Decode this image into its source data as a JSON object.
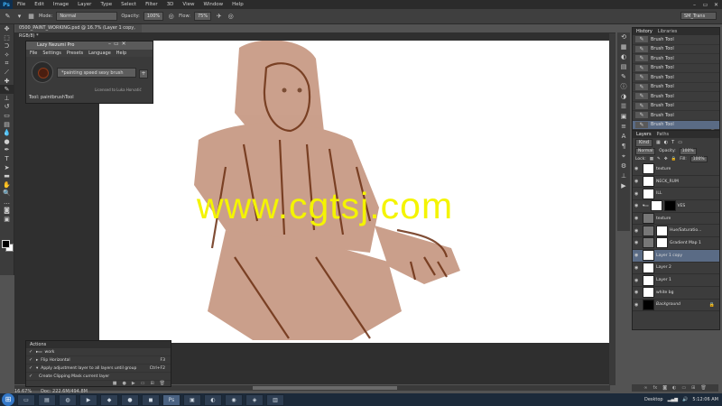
{
  "app": {
    "logo": "Ps"
  },
  "menubar": {
    "items": [
      "File",
      "Edit",
      "Image",
      "Layer",
      "Type",
      "Select",
      "Filter",
      "3D",
      "View",
      "Window",
      "Help"
    ]
  },
  "window_controls": {
    "minimize": "–",
    "maximize": "▭",
    "close": "✕"
  },
  "options": {
    "mode_label": "Mode:",
    "mode_value": "Normal",
    "opacity_label": "Opacity:",
    "opacity_value": "100%",
    "flow_label": "Flow:",
    "flow_value": "75%",
    "workspace": "SM_Trans"
  },
  "document": {
    "tab": "0500_PAINT_WORKING.psd @ 16.7% (Layer 1 copy, RGB/8) *"
  },
  "lazy_nezumi": {
    "title": "Lazy Nezumi Pro",
    "menu": [
      "File",
      "Settings",
      "Presets",
      "Language",
      "Help"
    ],
    "preset": "*painting speed sexy brush",
    "license": "Licensed to Luka Horvatić",
    "tool_line": "Tool: paintbrushTool"
  },
  "actions": {
    "header": "Actions",
    "rows": [
      {
        "label": "work",
        "shortcut": ""
      },
      {
        "label": "Flip Horizontal",
        "shortcut": "F3"
      },
      {
        "label": "Apply adjustment layer to all layers until group",
        "shortcut": "Ctrl+F2"
      },
      {
        "label": "Create Clipping Mask current layer",
        "shortcut": ""
      }
    ]
  },
  "history": {
    "tabs": [
      "History",
      "Libraries"
    ],
    "items": [
      "Brush Tool",
      "Brush Tool",
      "Brush Tool",
      "Brush Tool",
      "Brush Tool",
      "Brush Tool",
      "Brush Tool",
      "Brush Tool",
      "Brush Tool",
      "Brush Tool"
    ]
  },
  "layers": {
    "tabs": [
      "Layers",
      "Paths"
    ],
    "filter_label": "Kind",
    "blend": "Normal",
    "opacity_label": "Opacity:",
    "opacity": "100%",
    "lock_label": "Lock:",
    "fill_label": "Fill:",
    "fill": "100%",
    "items": [
      {
        "name": "texture",
        "lock": ""
      },
      {
        "name": "NECK_RUM",
        "lock": ""
      },
      {
        "name": "ILL",
        "lock": ""
      },
      {
        "name": "VES",
        "lock": ""
      },
      {
        "name": "texture",
        "lock": ""
      },
      {
        "name": "Hue/Saturatio...",
        "lock": ""
      },
      {
        "name": "Gradient Map 1",
        "lock": ""
      },
      {
        "name": "Layer 1 copy",
        "lock": ""
      },
      {
        "name": "Layer 2",
        "lock": ""
      },
      {
        "name": "Layer 1",
        "lock": ""
      },
      {
        "name": "white bg",
        "lock": ""
      },
      {
        "name": "Background",
        "lock": "🔒"
      }
    ]
  },
  "status": {
    "zoom": "16.67%",
    "doc": "Doc: 222.6M/494.8M"
  },
  "canvas": {
    "watermark": "www.cgtsj.com",
    "paint_color": "#a0522d"
  },
  "taskbar": {
    "desktop": "Desktop",
    "time": "5:12:06 AM"
  },
  "colors": {
    "accent": "#5a6b85",
    "watermark": "#f4f400",
    "paint": "#8b4513"
  }
}
